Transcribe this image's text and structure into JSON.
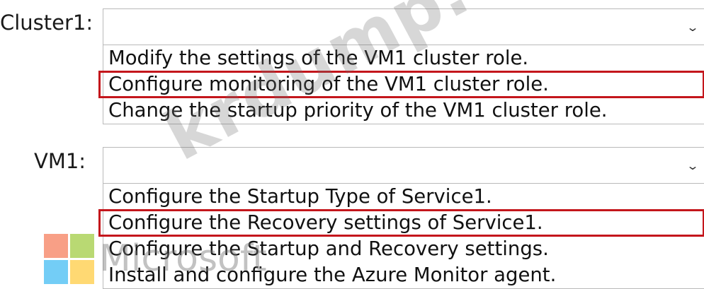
{
  "sections": [
    {
      "label": "Cluster1:",
      "options": [
        "Modify the settings of the VM1 cluster role.",
        "Configure monitoring of the VM1 cluster role.",
        "Change the startup priority of the VM1 cluster role."
      ],
      "selected_index": 1
    },
    {
      "label": "VM1:",
      "options": [
        "Configure the Startup Type of Service1.",
        "Configure the Recovery settings of Service1.",
        "Configure the Startup and Recovery settings.",
        "Install and configure the Azure Monitor agent."
      ],
      "selected_index": 1
    }
  ],
  "chevron_icon": "chevron-down-icon",
  "selection_color": "#c4161c",
  "watermark": "krdump.com",
  "logo_text": "Microsoft",
  "logo_colors": [
    "#f25022",
    "#7fba00",
    "#00a4ef",
    "#ffb900"
  ]
}
